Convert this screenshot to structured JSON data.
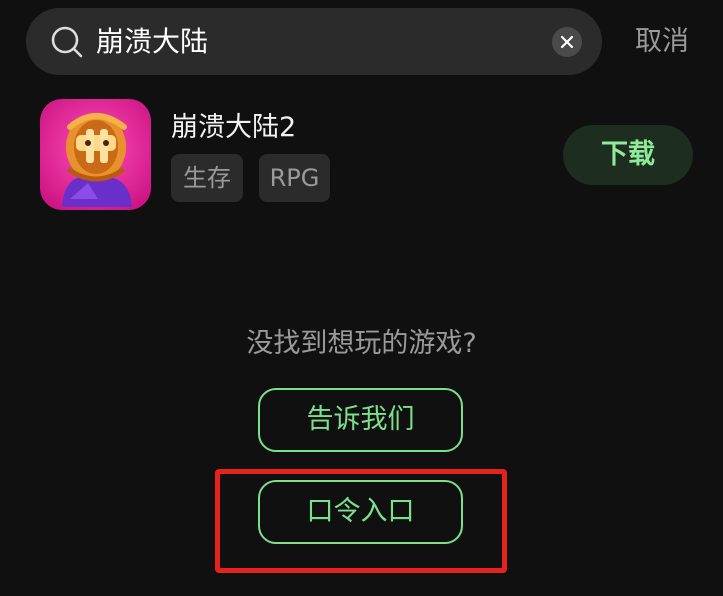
{
  "search": {
    "query": "崩溃大陆",
    "cancel_label": "取消"
  },
  "result": {
    "app_name": "崩溃大陆2",
    "tags": [
      "生存",
      "RPG"
    ],
    "download_label": "下载"
  },
  "empty_prompt": {
    "text": "没找到想玩的游戏?",
    "tell_us_label": "告诉我们",
    "code_entry_label": "口令入口"
  },
  "colors": {
    "background": "#101010",
    "accent_green": "#7be08c",
    "highlight_red": "#e5231c"
  }
}
